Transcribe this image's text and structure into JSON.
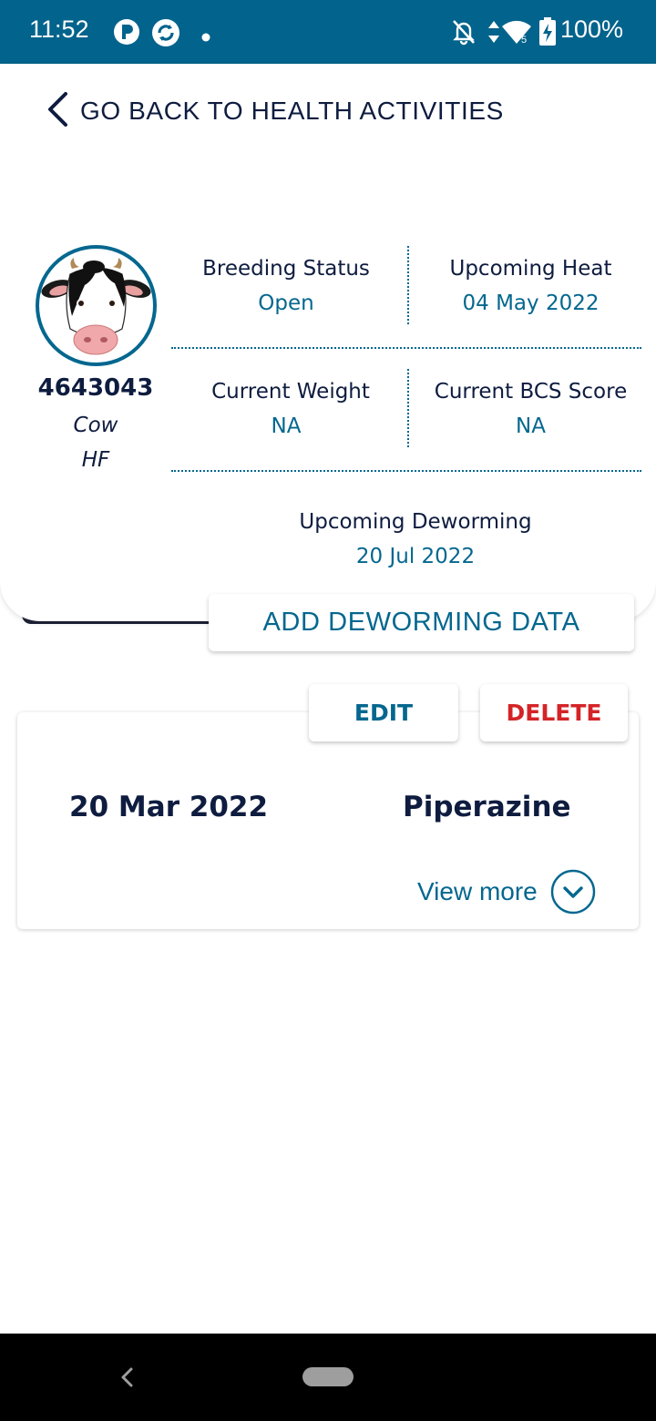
{
  "status_bar": {
    "time": "11:52",
    "battery": "100%",
    "icons": [
      "app-p-icon",
      "app-sync-icon",
      "notification-dot-icon",
      "bell-off-icon",
      "data-arrows-icon",
      "wifi-icon",
      "battery-charging-icon"
    ]
  },
  "header": {
    "back_label": "GO BACK TO HEALTH ACTIVITIES"
  },
  "animal": {
    "id": "4643043",
    "type": "Cow",
    "breed": "HF"
  },
  "stats": {
    "breeding_status": {
      "label": "Breeding Status",
      "value": "Open"
    },
    "upcoming_heat": {
      "label": "Upcoming Heat",
      "value": "04 May 2022"
    },
    "current_weight": {
      "label": "Current Weight",
      "value": "NA"
    },
    "current_bcs": {
      "label": "Current BCS Score",
      "value": "NA"
    },
    "upcoming_deworming": {
      "label": "Upcoming Deworming",
      "value": "20 Jul 2022"
    }
  },
  "actions": {
    "add_label": "ADD DEWORMING DATA"
  },
  "record": {
    "edit_label": "EDIT",
    "delete_label": "DELETE",
    "date": "20 Mar 2022",
    "drug": "Piperazine",
    "view_more_label": "View more"
  },
  "colors": {
    "primary": "#04678f",
    "status_bar": "#02638c",
    "text_dark": "#0e1c3f",
    "danger": "#d42427"
  }
}
